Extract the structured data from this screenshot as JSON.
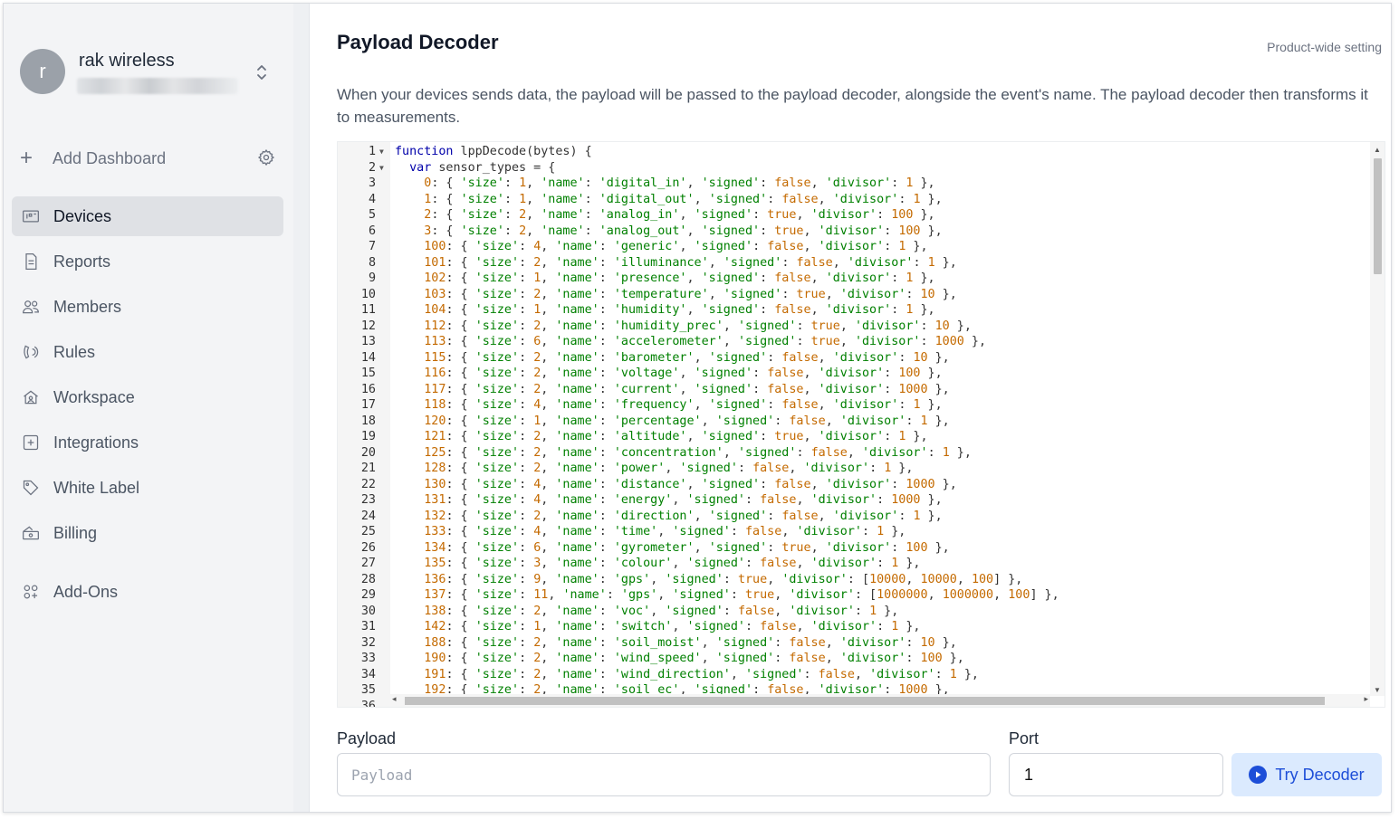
{
  "account": {
    "avatar_letter": "r",
    "name": "rak wireless"
  },
  "sidebar": {
    "add_dashboard": "Add Dashboard",
    "items": [
      {
        "label": "Devices",
        "icon": "devices-icon",
        "active": true
      },
      {
        "label": "Reports",
        "icon": "report-icon"
      },
      {
        "label": "Members",
        "icon": "members-icon"
      },
      {
        "label": "Rules",
        "icon": "rules-icon"
      },
      {
        "label": "Workspace",
        "icon": "workspace-icon"
      },
      {
        "label": "Integrations",
        "icon": "integrations-icon"
      },
      {
        "label": "White Label",
        "icon": "tag-icon"
      },
      {
        "label": "Billing",
        "icon": "billing-icon"
      }
    ],
    "addons": {
      "label": "Add-Ons",
      "icon": "addons-icon"
    }
  },
  "main": {
    "title": "Payload Decoder",
    "scope": "Product-wide setting",
    "description": "When your devices sends data, the payload will be passed to the payload decoder, alongside the event's name. The payload decoder then transforms it to measurements."
  },
  "editor": {
    "line_numbers": [
      "1",
      "2",
      "3",
      "4",
      "5",
      "6",
      "7",
      "8",
      "9",
      "10",
      "11",
      "12",
      "13",
      "14",
      "15",
      "16",
      "17",
      "18",
      "19",
      "20",
      "21",
      "22",
      "23",
      "24",
      "25",
      "26",
      "27",
      "28",
      "29",
      "30",
      "31",
      "32",
      "33",
      "34",
      "35",
      "36"
    ],
    "header_lines": [
      "function lppDecode(bytes) {",
      "  var sensor_types = {"
    ],
    "sensor_types": [
      {
        "id": "0",
        "size": "1",
        "name": "digital_in",
        "signed": "false",
        "divisor": "1"
      },
      {
        "id": "1",
        "size": "1",
        "name": "digital_out",
        "signed": "false",
        "divisor": "1"
      },
      {
        "id": "2",
        "size": "2",
        "name": "analog_in",
        "signed": "true",
        "divisor": "100"
      },
      {
        "id": "3",
        "size": "2",
        "name": "analog_out",
        "signed": "true",
        "divisor": "100"
      },
      {
        "id": "100",
        "size": "4",
        "name": "generic",
        "signed": "false",
        "divisor": "1"
      },
      {
        "id": "101",
        "size": "2",
        "name": "illuminance",
        "signed": "false",
        "divisor": "1"
      },
      {
        "id": "102",
        "size": "1",
        "name": "presence",
        "signed": "false",
        "divisor": "1"
      },
      {
        "id": "103",
        "size": "2",
        "name": "temperature",
        "signed": "true",
        "divisor": "10"
      },
      {
        "id": "104",
        "size": "1",
        "name": "humidity",
        "signed": "false",
        "divisor": "1"
      },
      {
        "id": "112",
        "size": "2",
        "name": "humidity_prec",
        "signed": "true",
        "divisor": "10"
      },
      {
        "id": "113",
        "size": "6",
        "name": "accelerometer",
        "signed": "true",
        "divisor": "1000"
      },
      {
        "id": "115",
        "size": "2",
        "name": "barometer",
        "signed": "false",
        "divisor": "10"
      },
      {
        "id": "116",
        "size": "2",
        "name": "voltage",
        "signed": "false",
        "divisor": "100"
      },
      {
        "id": "117",
        "size": "2",
        "name": "current",
        "signed": "false",
        "divisor": "1000"
      },
      {
        "id": "118",
        "size": "4",
        "name": "frequency",
        "signed": "false",
        "divisor": "1"
      },
      {
        "id": "120",
        "size": "1",
        "name": "percentage",
        "signed": "false",
        "divisor": "1"
      },
      {
        "id": "121",
        "size": "2",
        "name": "altitude",
        "signed": "true",
        "divisor": "1"
      },
      {
        "id": "125",
        "size": "2",
        "name": "concentration",
        "signed": "false",
        "divisor": "1"
      },
      {
        "id": "128",
        "size": "2",
        "name": "power",
        "signed": "false",
        "divisor": "1"
      },
      {
        "id": "130",
        "size": "4",
        "name": "distance",
        "signed": "false",
        "divisor": "1000"
      },
      {
        "id": "131",
        "size": "4",
        "name": "energy",
        "signed": "false",
        "divisor": "1000"
      },
      {
        "id": "132",
        "size": "2",
        "name": "direction",
        "signed": "false",
        "divisor": "1"
      },
      {
        "id": "133",
        "size": "4",
        "name": "time",
        "signed": "false",
        "divisor": "1"
      },
      {
        "id": "134",
        "size": "6",
        "name": "gyrometer",
        "signed": "true",
        "divisor": "100"
      },
      {
        "id": "135",
        "size": "3",
        "name": "colour",
        "signed": "false",
        "divisor": "1"
      },
      {
        "id": "136",
        "size": "9",
        "name": "gps",
        "signed": "true",
        "divisor": "[10000, 10000, 100]"
      },
      {
        "id": "137",
        "size": "11",
        "name": "gps",
        "signed": "true",
        "divisor": "[1000000, 1000000, 100]"
      },
      {
        "id": "138",
        "size": "2",
        "name": "voc",
        "signed": "false",
        "divisor": "1"
      },
      {
        "id": "142",
        "size": "1",
        "name": "switch",
        "signed": "false",
        "divisor": "1"
      },
      {
        "id": "188",
        "size": "2",
        "name": "soil_moist",
        "signed": "false",
        "divisor": "10"
      },
      {
        "id": "190",
        "size": "2",
        "name": "wind_speed",
        "signed": "false",
        "divisor": "100"
      },
      {
        "id": "191",
        "size": "2",
        "name": "wind_direction",
        "signed": "false",
        "divisor": "1"
      },
      {
        "id": "192",
        "size": "2",
        "name": "soil_ec",
        "signed": "false",
        "divisor": "1000"
      }
    ]
  },
  "form": {
    "payload_label": "Payload",
    "payload_placeholder": "Payload",
    "port_label": "Port",
    "port_value": "1",
    "try_label": "Try Decoder"
  },
  "colors": {
    "accent": "#1d4ed8",
    "accent_bg": "#dbeafe",
    "sidebar_bg": "#f3f4f6",
    "active_bg": "#dfe1e5"
  }
}
